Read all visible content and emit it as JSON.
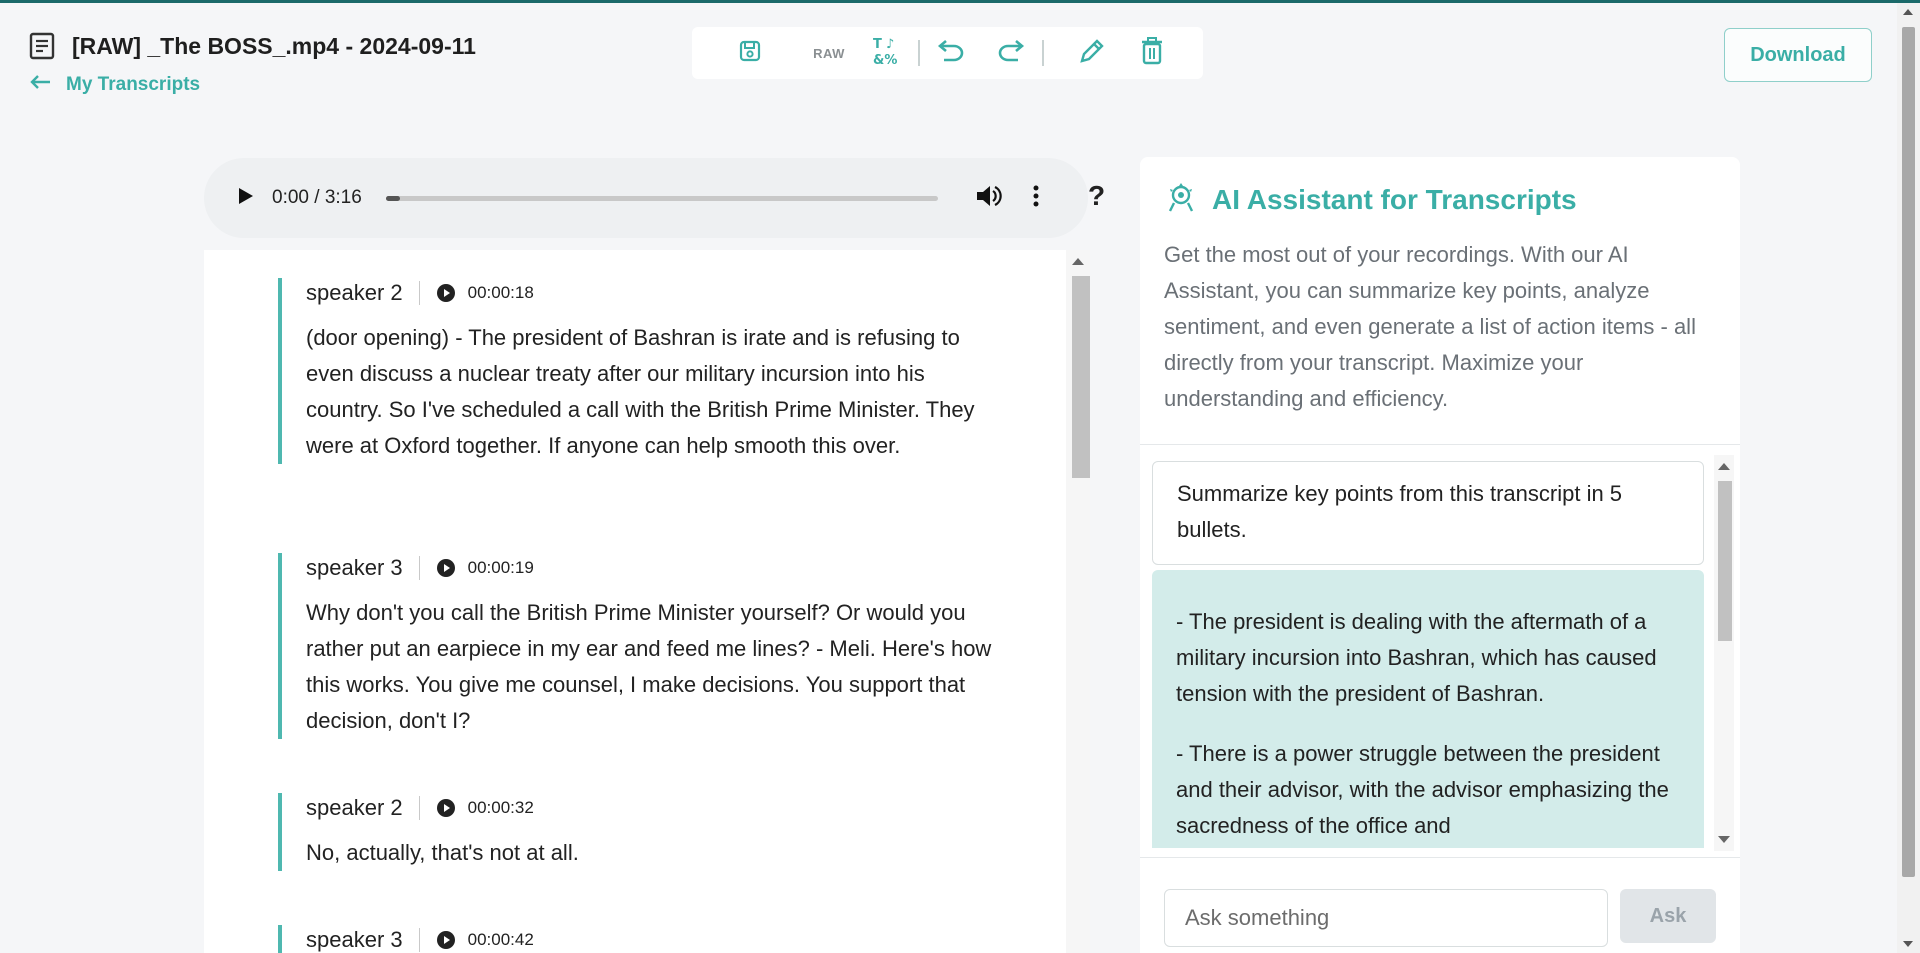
{
  "header": {
    "title": "[RAW] _The BOSS_.mp4 - 2024-09-11",
    "back_label": "My Transcripts",
    "download_label": "Download"
  },
  "toolbar": {
    "raw_label": "RAW",
    "icons": [
      "save-icon",
      "raw-icon",
      "find-replace-icon",
      "undo-icon",
      "redo-icon",
      "edit-icon",
      "delete-icon"
    ]
  },
  "player": {
    "time": "0:00 / 3:16",
    "progress": 0,
    "help_label": "?"
  },
  "transcript": {
    "segments": [
      {
        "speaker": "speaker 2",
        "timestamp": "00:00:18",
        "text": "(door opening) - The president of Bashran is irate and is refusing to even discuss a nuclear treaty after our military incursion into his country. So I've scheduled a call with the British Prime Minister. They were at Oxford together. If anyone can help smooth this over."
      },
      {
        "speaker": "speaker 3",
        "timestamp": "00:00:19",
        "text": "Why don't you call the British Prime Minister yourself? Or would you rather put an earpiece in my ear and feed me lines? - Meli. Here's how this works. You give me counsel, I make decisions. You support that decision, don't I?"
      },
      {
        "speaker": "speaker 2",
        "timestamp": "00:00:32",
        "text": "No, actually, that's not at all."
      },
      {
        "speaker": "speaker 3",
        "timestamp": "00:00:42",
        "text": ""
      }
    ]
  },
  "ai": {
    "title": "AI Assistant for Transcripts",
    "description": "Get the most out of your recordings. With our AI Assistant, you can summarize key points, analyze sentiment, and even generate a list of action items - all directly from your transcript. Maximize your understanding and efficiency.",
    "question": "Summarize key points from this transcript in 5 bullets.",
    "answer_bullets": [
      "- The president is dealing with the aftermath of a military incursion into Bashran, which has caused tension with the president of Bashran.",
      "- There is a power struggle between the president and their advisor, with the advisor emphasizing the sacredness of the office and"
    ],
    "input_placeholder": "Ask something",
    "input_value": "",
    "ask_label": "Ask"
  },
  "colors": {
    "accent": "#3aaea6",
    "accent_border": "#4fb8b0",
    "answer_bg": "#d3ecea",
    "top_bar": "#1b6a6a"
  }
}
